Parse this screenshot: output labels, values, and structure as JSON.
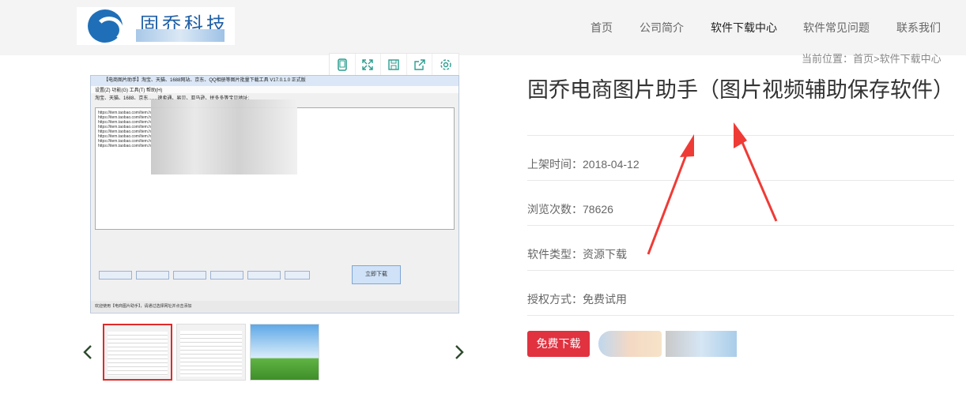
{
  "header": {
    "logo_text": "固乔科技",
    "nav": [
      "首页",
      "公司简介",
      "软件下载中心",
      "软件常见问题",
      "联系我们"
    ],
    "active_nav": "软件下载中心"
  },
  "breadcrumb": "当前位置：首页>软件下载中心",
  "toolbar": {
    "icons": [
      "tablet-icon",
      "fullscreen-icon",
      "save-icon",
      "share-icon",
      "settings-icon"
    ]
  },
  "screenshot": {
    "window_title": "【电商图片助手】淘宝、天猫、1688网站、京东、QQ相册等图片批量下载工具 V17.0.1.0 正式版",
    "menu": "设置(Z)    功能(G)    工具(T)    帮助(H)",
    "input_row": "淘宝、天猫、1688、京东……速卖通、易贝、亚马逊、拼多多等宝贝地址:",
    "start_button": "立即下载",
    "status": "欢迎使用【电商图片助手】，请通过选择网址并点击添加"
  },
  "product": {
    "title": "固乔电商图片助手（图片视频辅助保存软件）",
    "release_label": "上架时间：2018-04-12",
    "views_label": "浏览次数：78626",
    "type_label": "软件类型：资源下载",
    "license_label": "授权方式：免费试用",
    "download_button": "免费下载"
  },
  "colors": {
    "accent": "#e13240",
    "nav_bg": "#f4f4f4",
    "logo_blue": "#1f5fa6",
    "arrow_red": "#ef3b36"
  }
}
